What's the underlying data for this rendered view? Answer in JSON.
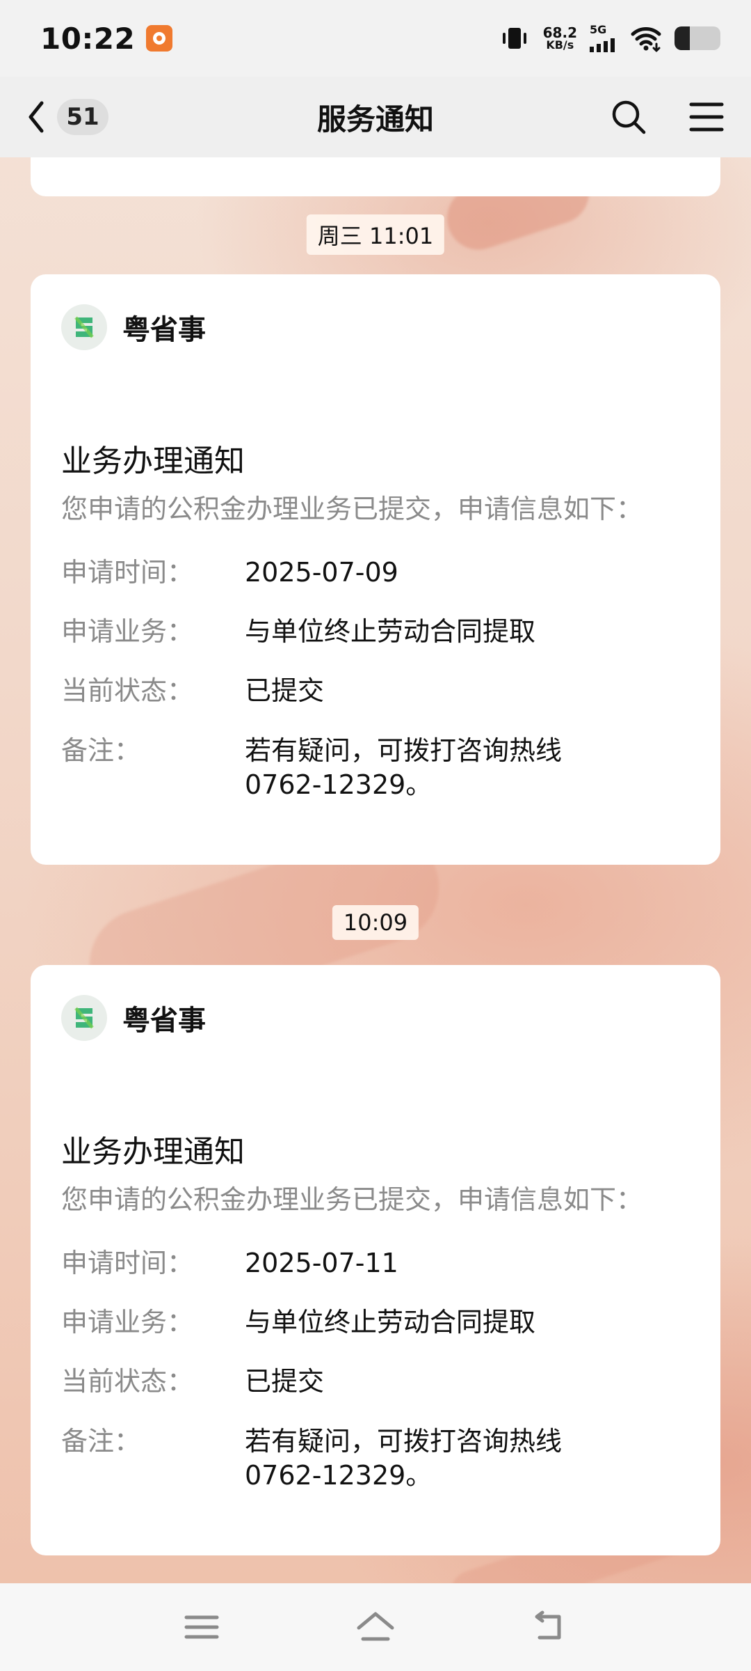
{
  "status_bar": {
    "time": "10:22",
    "net_speed_value": "68.2",
    "net_speed_unit": "KB/s",
    "network_type": "5G",
    "battery_level": 0.34
  },
  "header": {
    "unread_count": "51",
    "title": "服务通知"
  },
  "messages": [
    {
      "time": "周三 11:01",
      "sender": "粤省事",
      "title": "业务办理通知",
      "desc": "您申请的公积金办理业务已提交，申请信息如下：",
      "fields": [
        {
          "label": "申请时间：",
          "value": "2025-07-09"
        },
        {
          "label": "申请业务：",
          "value": "与单位终止劳动合同提取"
        },
        {
          "label": "当前状态：",
          "value": " 已提交"
        },
        {
          "label": "备注：",
          "value": " 若有疑问，可拨打咨询热线\n0762-12329。"
        }
      ]
    },
    {
      "time": "10:09",
      "sender": "粤省事",
      "title": "业务办理通知",
      "desc": "您申请的公积金办理业务已提交，申请信息如下：",
      "fields": [
        {
          "label": "申请时间：",
          "value": "2025-07-11"
        },
        {
          "label": "申请业务：",
          "value": "与单位终止劳动合同提取"
        },
        {
          "label": "当前状态：",
          "value": " 已提交"
        },
        {
          "label": "备注：",
          "value": " 若有疑问，可拨打咨询热线\n0762-12329。"
        }
      ]
    }
  ],
  "icons": {
    "back": "chevron-left-icon",
    "search": "search-icon",
    "menu": "menu-icon",
    "nav_menu": "nav-menu-icon",
    "nav_home": "home-icon",
    "nav_back": "back-return-icon"
  },
  "colors": {
    "card": "#ffffff",
    "muted_text": "#8a8a8a",
    "header_bg": "#efefef"
  }
}
